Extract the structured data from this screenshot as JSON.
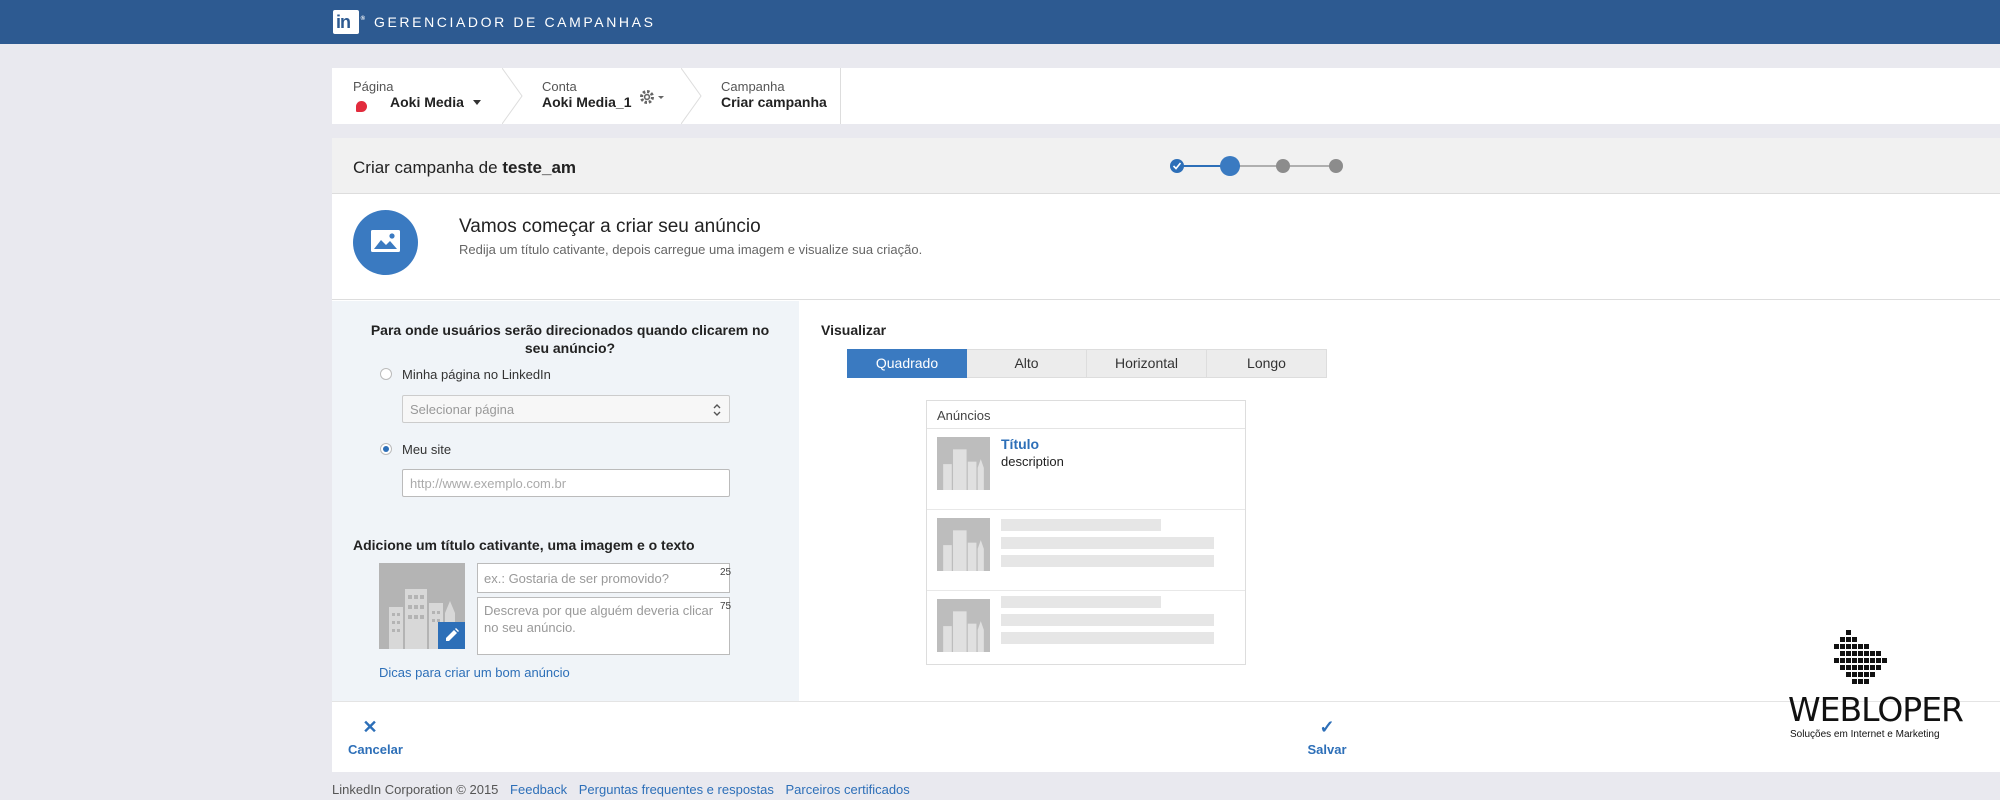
{
  "topbar": {
    "logo_text": "in",
    "title": "GERENCIADOR DE CAMPANHAS",
    "color": "#2d5a91"
  },
  "breadcrumb": {
    "page": {
      "label": "Página",
      "value": "Aoki Media"
    },
    "account": {
      "label": "Conta",
      "value": "Aoki Media_1"
    },
    "campaign": {
      "label": "Campanha",
      "value": "Criar campanha"
    }
  },
  "header": {
    "prefix": "Criar campanha de ",
    "name": "teste_am",
    "steps_total": 4,
    "steps_done": 1,
    "step_current": 2
  },
  "intro": {
    "title": "Vamos começar a criar seu anúncio",
    "subtitle": "Redija um título cativante, depois carregue uma imagem e visualize sua criação."
  },
  "destination": {
    "question": "Para onde usuários serão direcionados quando clicarem no seu anúncio?",
    "option_page": "Minha página no LinkedIn",
    "select_placeholder": "Selecionar página",
    "option_site": "Meu site",
    "selected": "Meu site",
    "url_placeholder": "http://www.exemplo.com.br"
  },
  "creative": {
    "section_title": "Adicione um título cativante, uma imagem e o texto",
    "headline_placeholder": "ex.: Gostaria de ser promovido?",
    "headline_count": "25",
    "desc_placeholder": "Descreva por que alguém deveria clicar no seu anúncio.",
    "desc_count": "75",
    "tips_link": "Dicas para criar um bom anúncio"
  },
  "preview": {
    "label": "Visualizar",
    "tabs": [
      "Quadrado",
      "Alto",
      "Horizontal",
      "Longo"
    ],
    "active_tab": "Quadrado",
    "box_title": "Anúncios",
    "ad_title": "Título",
    "ad_description": "description"
  },
  "actions": {
    "cancel": "Cancelar",
    "save": "Salvar"
  },
  "footer": {
    "copyright": "LinkedIn Corporation © 2015",
    "links": [
      "Feedback",
      "Perguntas frequentes e respostas",
      "Parceiros certificados"
    ]
  },
  "watermark": {
    "name": "WEBLOPER",
    "tagline": "Soluções em Internet e Marketing"
  },
  "colors": {
    "accent": "#2d6fb8",
    "header_blue": "#2d5a91",
    "brand_red": "#e22b3d"
  }
}
